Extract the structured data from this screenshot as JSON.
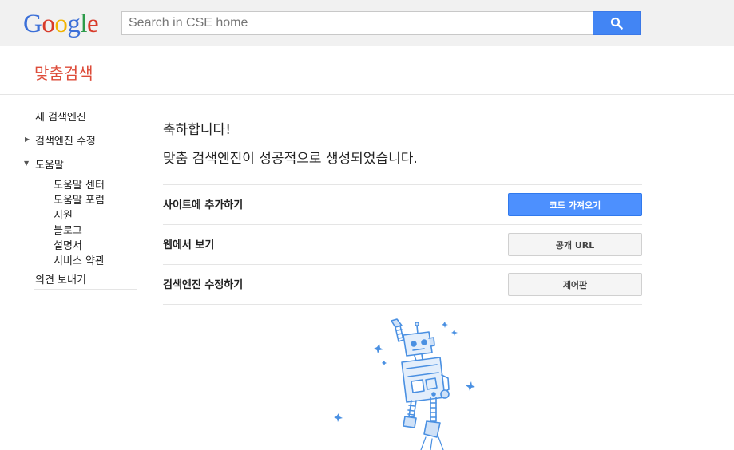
{
  "brand": {
    "logo_letters": [
      "G",
      "o",
      "o",
      "g",
      "l",
      "e"
    ],
    "logo_colors": [
      "#3b6fd8",
      "#d83b2a",
      "#f2b300",
      "#3b6fd8",
      "#2d9b4a",
      "#d83b2a"
    ]
  },
  "search": {
    "placeholder": "Search in CSE home",
    "button_icon": "search-icon"
  },
  "header": {
    "title": "맞춤검색"
  },
  "sidebar": {
    "new_engine": "새 검색엔진",
    "edit_engine": "검색엔진 수정",
    "help": "도움말",
    "help_items": [
      "도움말 센터",
      "도움말 포럼",
      "지원",
      "블로그",
      "설명서",
      "서비스 약관"
    ],
    "feedback": "의견 보내기"
  },
  "main": {
    "congrats": "축하합니다!",
    "success": "맞춤 검색엔진이 성공적으로 생성되었습니다.",
    "rows": [
      {
        "label": "사이트에 추가하기",
        "button": "코드 가져오기"
      },
      {
        "label": "웹에서 보기",
        "button": "공개 URL"
      },
      {
        "label": "검색엔진 수정하기",
        "button": "제어판"
      }
    ]
  },
  "colors": {
    "accent_blue": "#4285f4",
    "title_red": "#dd4b39",
    "robot_blue": "#4a90e2"
  }
}
